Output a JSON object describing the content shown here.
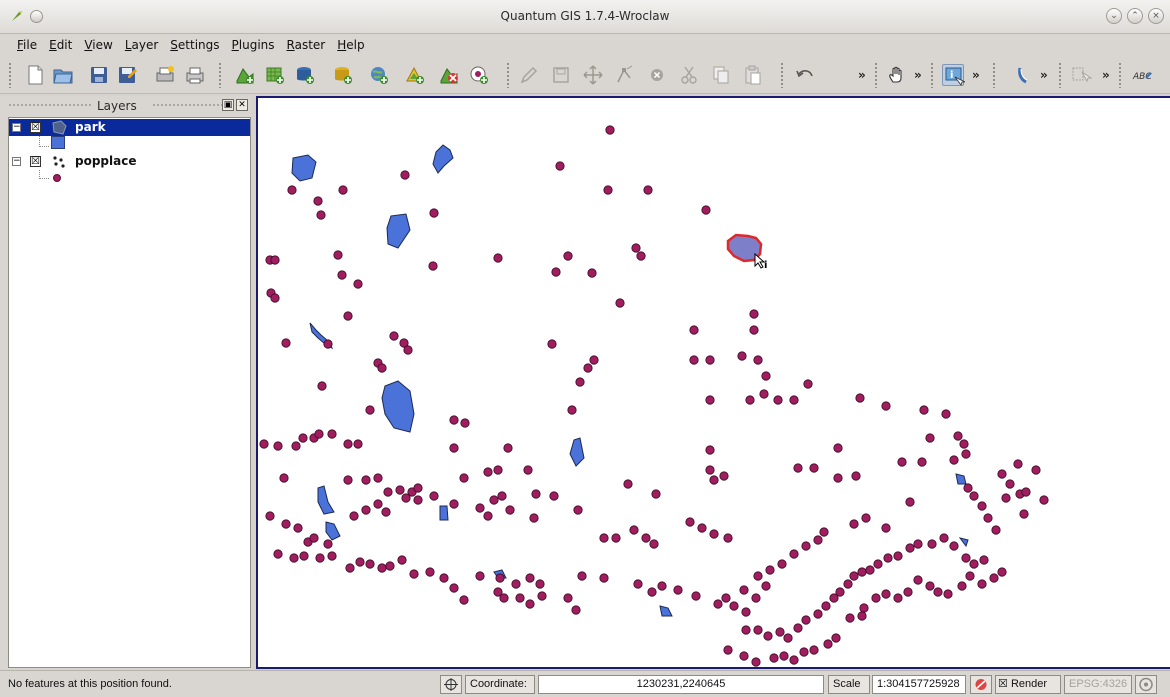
{
  "window": {
    "title": "Quantum GIS 1.7.4-Wroclaw"
  },
  "menu": {
    "items": [
      {
        "mnemonic": "F",
        "rest": "ile"
      },
      {
        "mnemonic": "E",
        "rest": "dit"
      },
      {
        "mnemonic": "V",
        "rest": "iew"
      },
      {
        "mnemonic": "L",
        "rest": "ayer"
      },
      {
        "mnemonic": "S",
        "rest": "ettings"
      },
      {
        "mnemonic": "P",
        "rest": "lugins"
      },
      {
        "mnemonic": "R",
        "rest": "aster"
      },
      {
        "mnemonic": "H",
        "rest": "elp"
      }
    ]
  },
  "toolbar": {
    "more_glyph": "»",
    "icons": [
      "new-project-icon",
      "open-project-icon",
      "save-project-icon",
      "save-as-icon",
      "print-composer-icon",
      "print-icon",
      "add-vector-layer-icon",
      "add-raster-layer-icon",
      "add-postgis-layer-icon",
      "add-spatialite-layer-icon",
      "add-wms-layer-icon",
      "add-wfs-layer-icon",
      "remove-layer-icon",
      "new-layer-icon",
      "edit-pencil-icon",
      "save-edits-icon",
      "move-feature-icon",
      "node-tool-icon",
      "delete-selected-icon",
      "cut-features-icon",
      "copy-features-icon",
      "paste-features-icon",
      "undo-icon",
      "pan-icon",
      "identify-icon",
      "measure-icon",
      "select-icon",
      "label-icon"
    ]
  },
  "layers_panel": {
    "title": "Layers",
    "layers": [
      {
        "name": "park",
        "checked": "☒",
        "selected": true,
        "fill_color": "#4a72d8"
      },
      {
        "name": "popplace",
        "checked": "☒",
        "selected": false,
        "fill_color": "#a01d5f"
      }
    ]
  },
  "status": {
    "message": "No features at this position found.",
    "coordinate_label": "Coordinate:",
    "coordinate_value": "1230231,2240645",
    "scale_label": "Scale",
    "scale_value": "1:304157725928",
    "render_label": "Render",
    "render_checked": "☒",
    "crs": "EPSG:4326"
  },
  "colors": {
    "point_fill": "#a01d5f",
    "park_fill": "#4a72d8",
    "selection": "#e0282a",
    "layer_selected_bg": "#0a2a9c"
  }
}
